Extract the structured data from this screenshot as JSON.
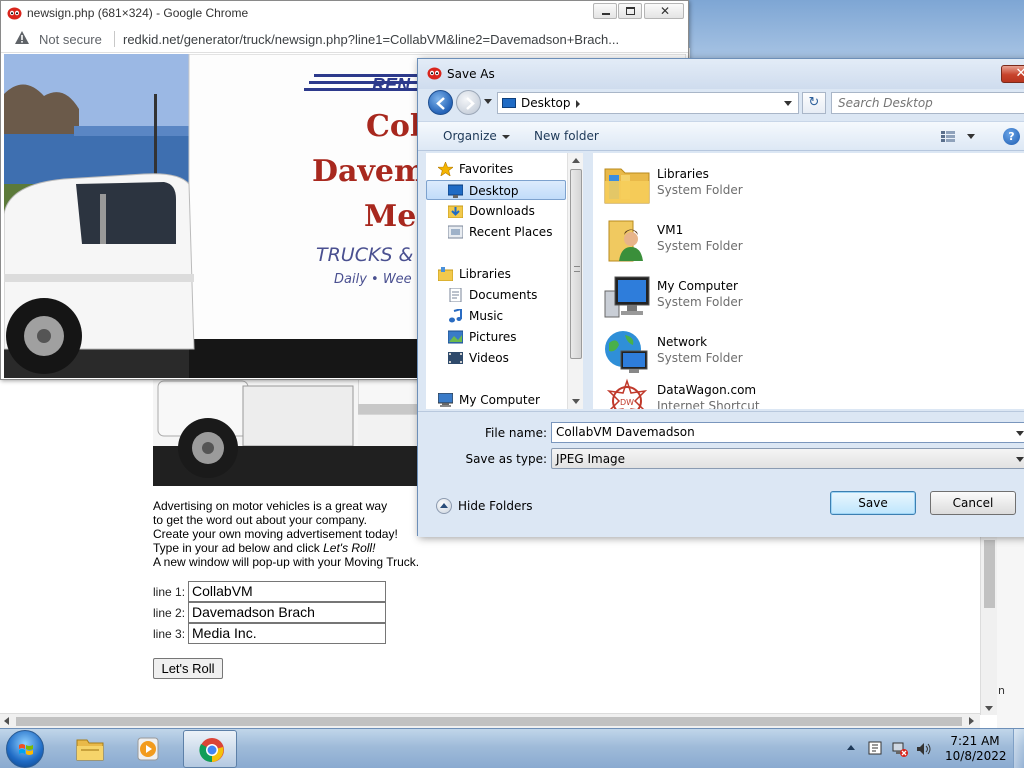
{
  "popup": {
    "title": "newsign.php (681×324) - Google Chrome",
    "security_label": "Not secure",
    "url": "redkid.net/generator/truck/newsign.php?line1=CollabVM&line2=Davemadson+Brach..."
  },
  "truck_sign": {
    "brand": "REN",
    "line1": "Coll",
    "line2": "Davemads",
    "line3": "Med",
    "tagline1": "TRUCKS &",
    "tagline2": "Daily • Wee"
  },
  "page": {
    "text_line1": "Advertising on motor vehicles is a great way",
    "text_line2": "to get the word out about your company.",
    "text_line3": "Create your own moving advertisement today!",
    "text_line4_prefix": "Type in your ad below and click ",
    "text_line4_em": "Let's Roll!",
    "text_line5": "A new window will pop-up with your Moving Truck.",
    "line1_label": "line 1:",
    "line1_value": "CollabVM",
    "line2_label": "line 2:",
    "line2_value": "Davemadson Brach",
    "line3_label": "line 3:",
    "line3_value": "Media Inc.",
    "button_label": "Let's Roll",
    "corner_char": "n"
  },
  "dialog": {
    "title": "Save As",
    "close_label": "✕",
    "path_label": "Desktop",
    "search_placeholder": "Search Desktop",
    "refresh_label": "↻",
    "organize_label": "Organize",
    "new_folder_label": "New folder",
    "help_label": "?",
    "nav_items": [
      {
        "label": "Favorites",
        "icon": "star-icon"
      },
      {
        "label": "Desktop",
        "icon": "desktop-icon",
        "selected": true
      },
      {
        "label": "Downloads",
        "icon": "downloads-icon"
      },
      {
        "label": "Recent Places",
        "icon": "recent-places-icon"
      },
      {
        "label": "Libraries",
        "icon": "libraries-icon"
      },
      {
        "label": "Documents",
        "icon": "documents-icon"
      },
      {
        "label": "Music",
        "icon": "music-icon"
      },
      {
        "label": "Pictures",
        "icon": "pictures-icon"
      },
      {
        "label": "Videos",
        "icon": "videos-icon"
      },
      {
        "label": "My Computer",
        "icon": "computer-icon"
      }
    ],
    "files": [
      {
        "name": "Libraries",
        "type": "System Folder",
        "icon": "libraries-folder-icon"
      },
      {
        "name": "VM1",
        "type": "System Folder",
        "icon": "user-folder-icon"
      },
      {
        "name": "My Computer",
        "type": "System Folder",
        "icon": "computer-icon"
      },
      {
        "name": "Network",
        "type": "System Folder",
        "icon": "network-icon"
      },
      {
        "name": "DataWagon.com",
        "type": "Internet Shortcut",
        "icon": "internet-shortcut-icon"
      }
    ],
    "file_name_label": "File name:",
    "file_name_value": "CollabVM Davemadson",
    "save_type_label": "Save as type:",
    "save_type_value": "JPEG Image",
    "hide_folders_label": "Hide Folders",
    "save_label": "Save",
    "cancel_label": "Cancel"
  },
  "taskbar": {
    "apps": [
      {
        "name": "windows-explorer",
        "icon": "folder-icon",
        "active": false
      },
      {
        "name": "media-player",
        "icon": "media-player-icon",
        "active": false
      },
      {
        "name": "google-chrome",
        "icon": "chrome-icon",
        "active": true
      }
    ],
    "time": "7:21 AM",
    "date": "10/8/2022"
  },
  "colors": {
    "taskbar": "#9fbbd9",
    "dialog_bg": "#dce7f4",
    "sign_red": "#a8281e",
    "sign_blue": "#2d3a8c"
  }
}
